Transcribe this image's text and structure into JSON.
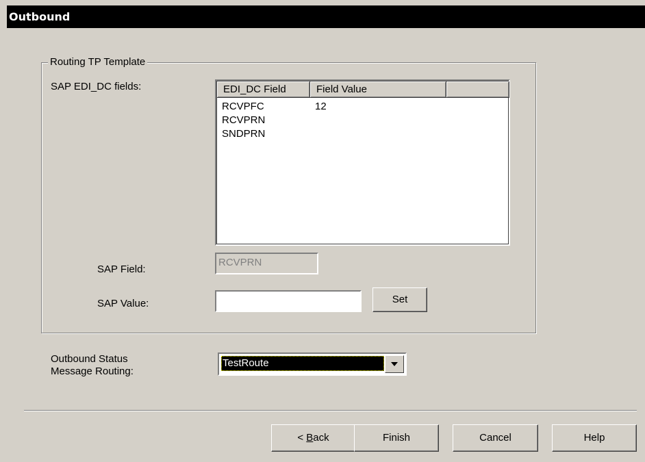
{
  "window": {
    "title": "Outbound"
  },
  "group": {
    "legend": "Routing TP Template"
  },
  "edi": {
    "label": "SAP EDI_DC fields:",
    "columns": [
      "EDI_DC Field",
      "Field Value",
      ""
    ],
    "rows": [
      {
        "field": "RCVPFC",
        "value": "12"
      },
      {
        "field": "RCVPRN",
        "value": ""
      },
      {
        "field": "SNDPRN",
        "value": ""
      }
    ]
  },
  "sap_field": {
    "label": "SAP Field:",
    "value": "RCVPRN"
  },
  "sap_value": {
    "label": "SAP Value:",
    "value": "",
    "set_button": "Set"
  },
  "status_routing": {
    "label_line1": "Outbound Status",
    "label_line2": "Message Routing:",
    "selected": "TestRoute"
  },
  "buttons": {
    "back_prefix": "< ",
    "back_mnemonic": "B",
    "back_rest": "ack",
    "finish": "Finish",
    "cancel": "Cancel",
    "help": "Help"
  },
  "icons": {
    "combo_arrow": "triangle-down-icon"
  }
}
